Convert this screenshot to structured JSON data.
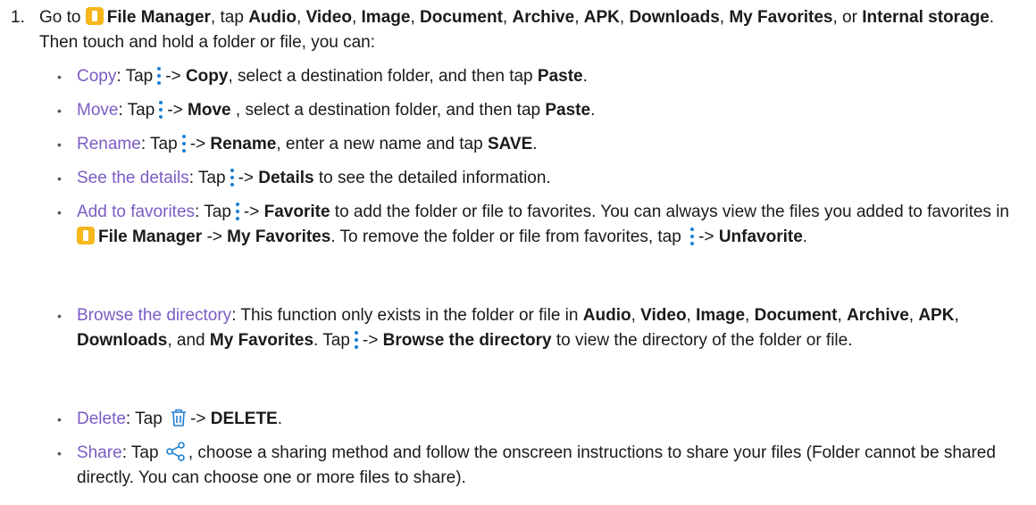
{
  "step": {
    "number": "1.",
    "t1": "Go to",
    "app": "File Manager",
    "t2": ", tap",
    "audio": "Audio",
    "video": "Video",
    "image": "Image",
    "document": "Document",
    "archive": "Archive",
    "apk": "APK",
    "downloads": "Downloads",
    "favorites": "My Favorites",
    "t3": ", or",
    "internal": "Internal storage",
    "t4": ". Then touch and hold a folder or file, you can:"
  },
  "bullets": {
    "copy": {
      "term": "Copy",
      "tap": ": Tap",
      "arrow": "->",
      "cmd": "Copy",
      "mid": ", select a destination folder, and then tap",
      "cmd2": "Paste",
      "end": "."
    },
    "move": {
      "term": "Move",
      "tap": ": Tap",
      "arrow": "->",
      "cmd": "Move",
      "mid": " , select a destination folder, and then tap",
      "cmd2": "Paste",
      "end": "."
    },
    "rename": {
      "term": "Rename",
      "tap": ": Tap",
      "arrow": "->",
      "cmd": "Rename",
      "mid": ", enter a new name and tap",
      "cmd2": "SAVE",
      "end": "."
    },
    "details": {
      "term": "See the details",
      "tap": ": Tap",
      "arrow": "->",
      "cmd": "Details",
      "end": " to see the detailed information."
    },
    "favorite": {
      "term": "Add to favorites",
      "tap": ": Tap",
      "arrow": "->",
      "cmd": "Favorite",
      "mid": " to add the folder or file to favorites. You can always view the files you added to favorites in",
      "app": "File Manager",
      "arrow2": "->",
      "cmd2": "My Favorites",
      "mid2": ". To remove the folder or file from favorites, tap",
      "arrow3": "->",
      "cmd3": "Unfavorite",
      "end": "."
    },
    "browse": {
      "term": "Browse the directory",
      "mid": ": This function only exists in the folder or file in",
      "l1": "Audio",
      "l2": "Video",
      "l3": "Image",
      "l4": "Document",
      "l5": "Archive",
      "l6": "APK",
      "l7": "Downloads",
      "and": ", and",
      "l8": "My Favorites",
      "tap": ". Tap",
      "arrow": "->",
      "cmd": "Browse the directory",
      "end": " to view the directory of the folder or file."
    },
    "delete": {
      "term": "Delete",
      "tap": ": Tap",
      "arrow": "->",
      "cmd": "DELETE",
      "end": "."
    },
    "share": {
      "term": "Share",
      "tap": ": Tap",
      "end": ", choose a sharing method and follow the onscreen instructions to share your files (Folder cannot be shared directly. You can choose one or more files to share)."
    }
  },
  "colors": {
    "term": "#7b5cc4",
    "icon_blue": "#1e7fd0",
    "app_icon": "#f5b719"
  },
  "icons": [
    "file-manager-app-icon",
    "more-options-icon",
    "delete-trash-icon",
    "share-icon"
  ]
}
